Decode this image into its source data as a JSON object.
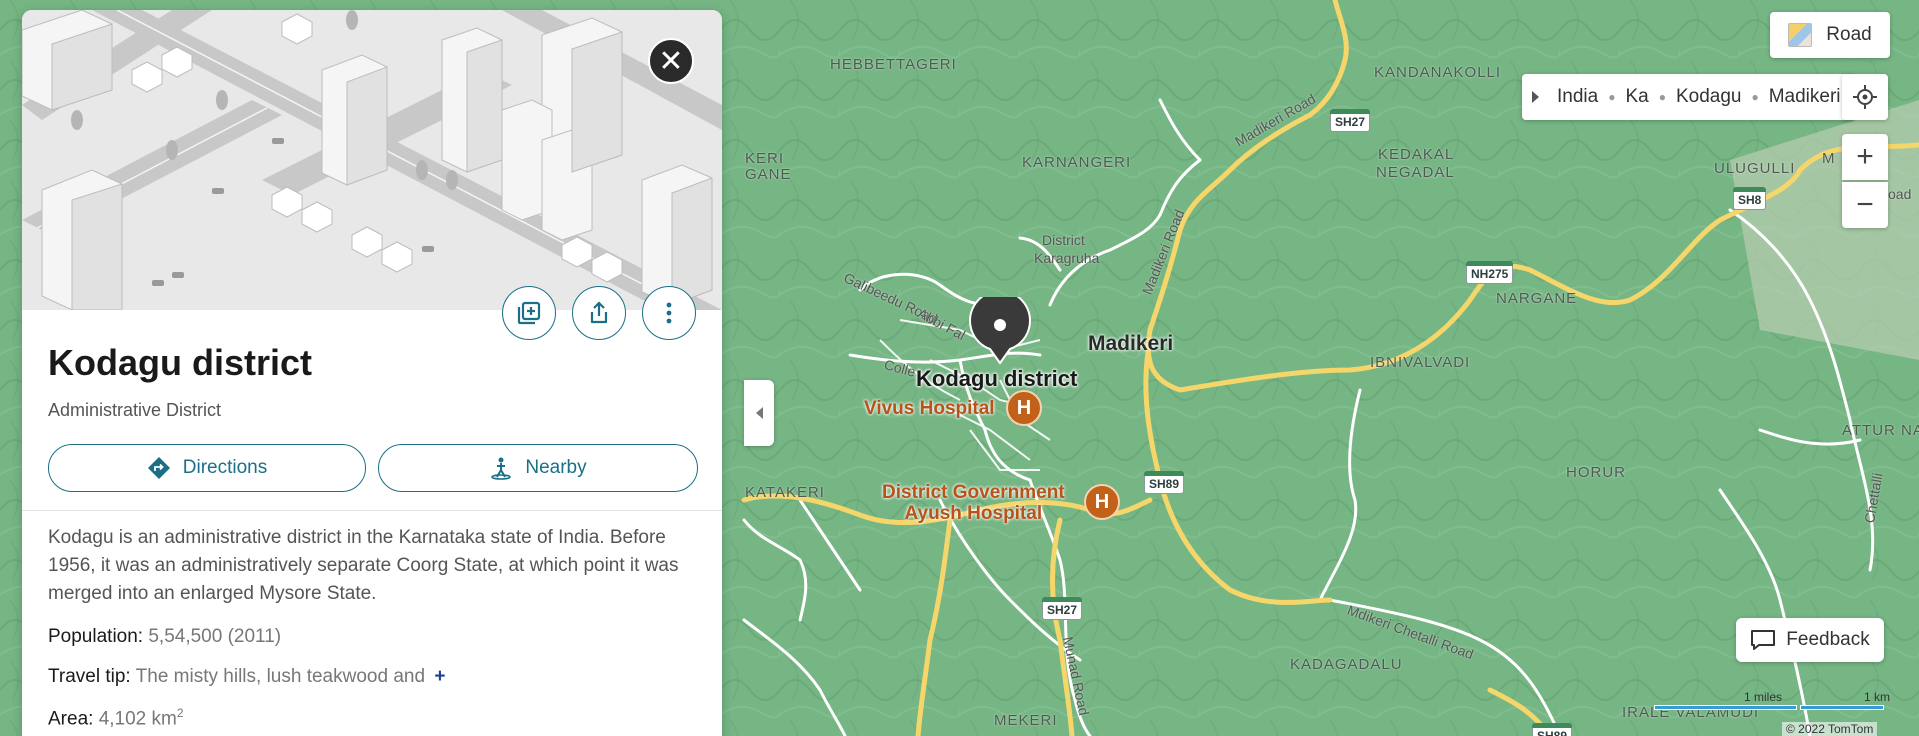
{
  "panel": {
    "title": "Kodagu district",
    "subtitle": "Administrative District",
    "directions_label": "Directions",
    "nearby_label": "Nearby",
    "description": "Kodagu is an administrative district in the Karnataka state of India. Before 1956, it was an administratively separate Coorg State, at which point it was merged into an enlarged Mysore State.",
    "facts": {
      "population_key": "Population:",
      "population_value": "5,54,500 (2011)",
      "travel_key": "Travel tip:",
      "travel_value": "The misty hills, lush teakwood and",
      "area_key": "Area:",
      "area_value": "4,102 km",
      "area_sup": "2"
    },
    "icons": [
      "close-icon",
      "save-icon",
      "share-icon",
      "more-icon",
      "directions-icon",
      "nearby-icon",
      "expand-icon"
    ]
  },
  "map": {
    "style_label": "Road",
    "breadcrumb": [
      "India",
      "Ka",
      "Kodagu",
      "Madikeri"
    ],
    "feedback_label": "Feedback",
    "zoom_in": "+",
    "zoom_out": "−",
    "scale_miles": "1 miles",
    "scale_km": "1 km",
    "copyright": "© 2022 TomTom",
    "pin_label": "Kodagu district",
    "places": {
      "hebbettageri": "HEBBETTAGERI",
      "kandanakolli": "KANDANAKOLLI",
      "kedakal": "KEDAKAL",
      "negadal": "NEGADAL",
      "karnangeri": "KARNANGERI",
      "keri": "KERI",
      "gane": "GANE",
      "ulugulli": "ULUGULLI",
      "m_partial": "M",
      "oad_partial": "oad",
      "nargane": "NARGANE",
      "ibnivalvadi": "IBNIVALVADI",
      "attur": "ATTUR NA",
      "horur": "HORUR",
      "katakeri": "KATAKERI",
      "kadagadalu": "KADAGADALU",
      "mekeri": "MEKERI",
      "irale": "IRALE VALAMUDI"
    },
    "district_office_line1": "District",
    "district_office_line2": "Karagruha",
    "city": "Madikeri",
    "pois": {
      "vivus": "Vivus Hospital",
      "ayush_line1": "District Government",
      "ayush_line2": "Ayush Hospital"
    },
    "roads": {
      "madikeri_road_1": "Madikeri Road",
      "madikeri_road_2": "Madikeri Road",
      "galibeedu": "Galibeedu Road",
      "abbi": "Abbi Fal",
      "colle": "Colle",
      "chettalli": "Chettalli",
      "chetalli_road": "Mdikeri Chetalli Road",
      "munad_road": "Munad Road"
    },
    "shields": {
      "sh27a": "SH27",
      "sh8": "SH8",
      "nh275": "NH275",
      "sh89": "SH89",
      "sh27b": "SH27",
      "sh89b": "SH89"
    },
    "hospital_glyph": "H",
    "colors": {
      "forest": "#76b584",
      "road_major": "#f5d66b",
      "road_minor": "#ffffff",
      "poi": "#c2621a",
      "accent": "#1b6f86"
    }
  }
}
